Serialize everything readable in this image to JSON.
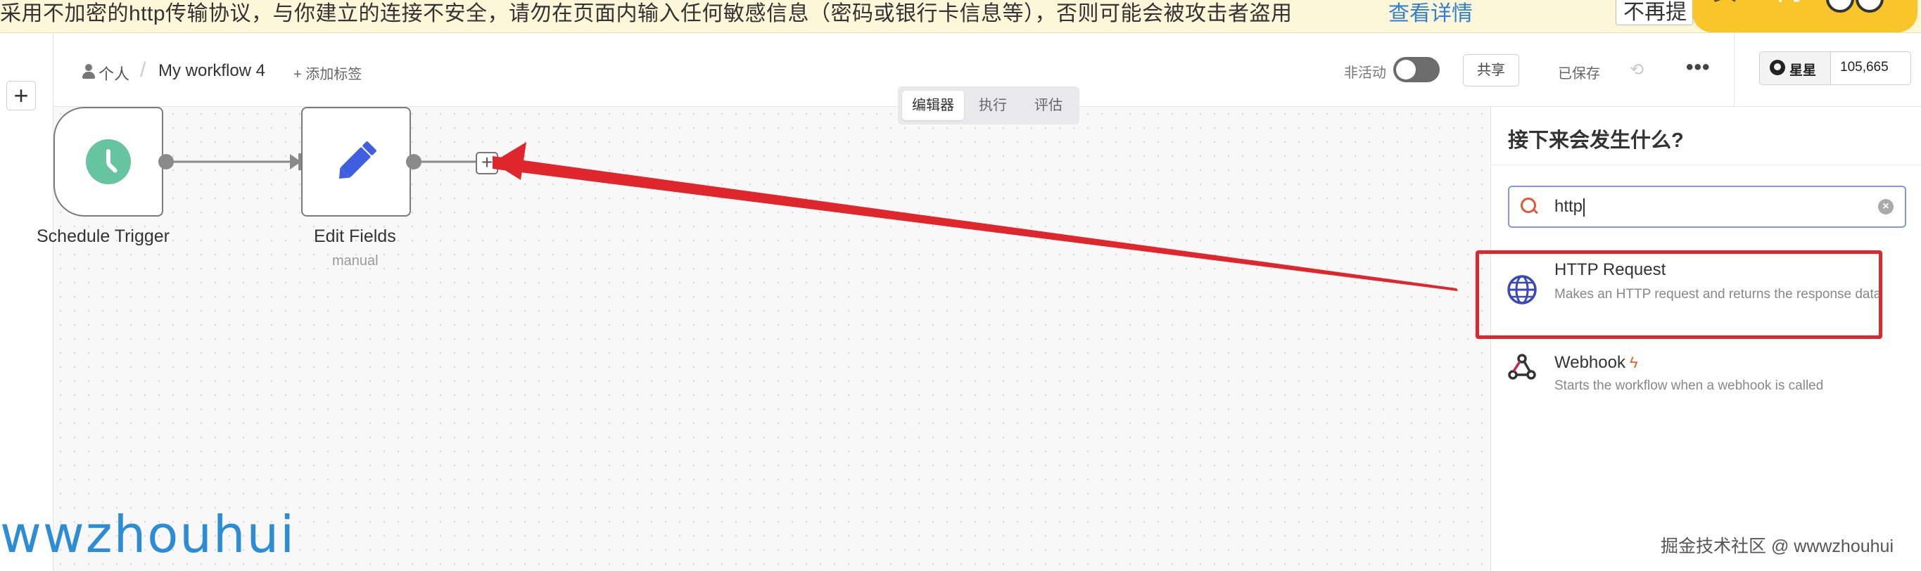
{
  "banner": {
    "text": "采用不加密的http传输协议，与你建立的连接不安全，请勿在页面内输入任何敏感信息（密码或银行卡信息等），否则可能会被攻击者盗用",
    "link": "查看详情",
    "dismiss": "不再提",
    "pill_left": "实",
    "pill_right": "简"
  },
  "rail": {
    "add": "+"
  },
  "header": {
    "owner": "个人",
    "separator": "/",
    "workflow_name": "My workflow 4",
    "add_tag": "+ 添加标签",
    "status_label": "非活动",
    "share": "共享",
    "saved": "已保存",
    "history_icon": "history-icon",
    "more": "•••",
    "github": {
      "label": "星星",
      "count": "105,665"
    }
  },
  "tabs": [
    {
      "label": "编辑器",
      "active": true
    },
    {
      "label": "执行",
      "active": false
    },
    {
      "label": "评估",
      "active": false
    }
  ],
  "nodes": {
    "trigger": {
      "label": "Schedule Trigger",
      "icon": "clock-icon",
      "color": "#66c5a0"
    },
    "edit": {
      "label": "Edit Fields",
      "sub": "manual",
      "icon": "pencil-icon",
      "color": "#3f5ee0"
    }
  },
  "panel": {
    "title": "接下来会发生什么?",
    "search_value": "http",
    "results": [
      {
        "title": "HTTP Request",
        "desc": "Makes an HTTP request and returns the response data",
        "icon": "globe-icon"
      },
      {
        "title": "Webhook",
        "desc": "Starts the workflow when a webhook is called",
        "icon": "webhook-icon",
        "badge": "ϟ"
      }
    ]
  },
  "annotation": {
    "color": "#e0262d"
  },
  "watermark": "wwzhouhui",
  "credit": "掘金技术社区 @ wwwzhouhui"
}
